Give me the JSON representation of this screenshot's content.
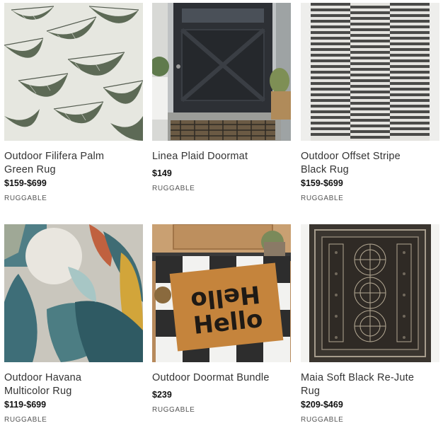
{
  "products": [
    {
      "title_line1": "Outdoor Filifera Palm",
      "title_line2": "Green Rug",
      "price": "$159-$699",
      "brand": "RUGGABLE",
      "image": "palm-leaf-rug"
    },
    {
      "title_line1": "Linea Plaid Doormat",
      "title_line2": "",
      "price": "$149",
      "brand": "RUGGABLE",
      "image": "plaid-doormat-at-door"
    },
    {
      "title_line1": "Outdoor Offset Stripe",
      "title_line2": "Black Rug",
      "price": "$159-$699",
      "brand": "RUGGABLE",
      "image": "offset-stripe-rug"
    },
    {
      "title_line1": "Outdoor Havana",
      "title_line2": "Multicolor Rug",
      "price": "$119-$699",
      "brand": "RUGGABLE",
      "image": "havana-leaf-rug"
    },
    {
      "title_line1": "Outdoor Doormat Bundle",
      "title_line2": "",
      "price": "$239",
      "brand": "RUGGABLE",
      "image": "hello-doormat-bundle"
    },
    {
      "title_line1": "Maia Soft Black Re-Jute",
      "title_line2": "Rug",
      "price": "$209-$469",
      "brand": "RUGGABLE",
      "image": "maia-jute-rug"
    }
  ],
  "hello_text": {
    "top": "Hello",
    "bottom": "Hello"
  }
}
